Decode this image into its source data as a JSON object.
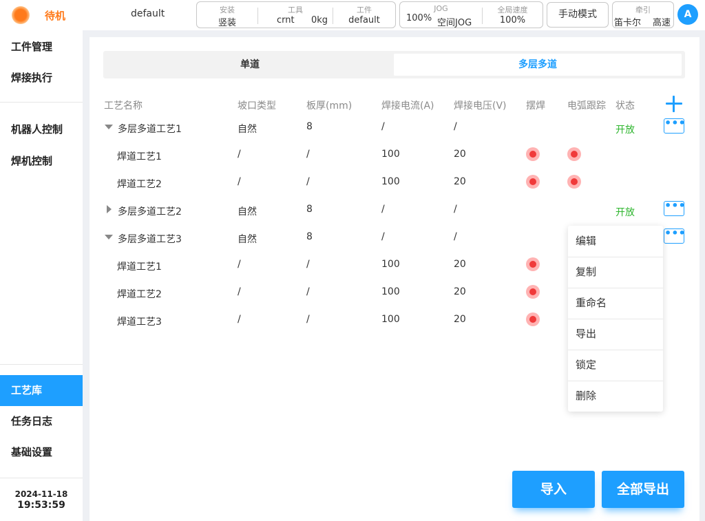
{
  "status": {
    "state_label": "待机"
  },
  "program": {
    "name": "default"
  },
  "info": {
    "install_label": "安装",
    "install_value": "竖装",
    "tool_label": "工具",
    "tool_name": "crnt",
    "tool_weight": "0kg",
    "workpiece_label": "工件",
    "workpiece_value": "default",
    "jog_label": "JOG",
    "jog_percent": "100%",
    "jog_mode": "空间JOG",
    "speed_label": "全局速度",
    "speed_value": "100%",
    "traction_label": "牵引",
    "traction_frame": "笛卡尔",
    "traction_speed": "高速"
  },
  "mode_button": "手动模式",
  "user": {
    "avatar": "A"
  },
  "sidebar": {
    "items": [
      "工件管理",
      "焊接执行",
      "机器人控制",
      "焊机控制",
      "工艺库",
      "任务日志",
      "基础设置"
    ],
    "date": "2024-11-18",
    "time": "19:53:59"
  },
  "tabs": [
    "单道",
    "多层多道"
  ],
  "table": {
    "headers": [
      "工艺名称",
      "坡口类型",
      "板厚(mm)",
      "焊接电流(A)",
      "焊接电压(V)",
      "摆焊",
      "电弧跟踪",
      "状态"
    ],
    "rows": [
      {
        "name": "多层多道工艺1",
        "groove": "自然",
        "thickness": "8",
        "current": "/",
        "voltage": "/",
        "state": "开放"
      },
      {
        "name": "焊道工艺1",
        "groove": "/",
        "thickness": "/",
        "current": "100",
        "voltage": "20"
      },
      {
        "name": "焊道工艺2",
        "groove": "/",
        "thickness": "/",
        "current": "100",
        "voltage": "20"
      },
      {
        "name": "多层多道工艺2",
        "groove": "自然",
        "thickness": "8",
        "current": "/",
        "voltage": "/",
        "state": "开放"
      },
      {
        "name": "多层多道工艺3",
        "groove": "自然",
        "thickness": "8",
        "current": "/",
        "voltage": "/"
      },
      {
        "name": "焊道工艺1",
        "groove": "/",
        "thickness": "/",
        "current": "100",
        "voltage": "20"
      },
      {
        "name": "焊道工艺2",
        "groove": "/",
        "thickness": "/",
        "current": "100",
        "voltage": "20"
      },
      {
        "name": "焊道工艺3",
        "groove": "/",
        "thickness": "/",
        "current": "100",
        "voltage": "20"
      }
    ],
    "more_symbol": "•••"
  },
  "context_menu": [
    "编辑",
    "复制",
    "重命名",
    "导出",
    "锁定",
    "删除"
  ],
  "actions": {
    "import": "导入",
    "export_all": "全部导出"
  },
  "colors": {
    "accent": "#1e9fff",
    "status": "#ff7a1a",
    "open": "#2db52d",
    "indicator": "#f03a3a"
  }
}
